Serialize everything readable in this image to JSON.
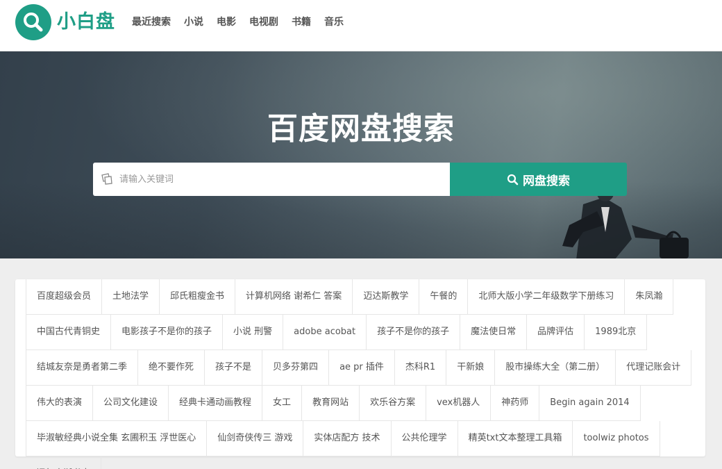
{
  "header": {
    "brand": "小白盘",
    "logo_icon": "search-icon",
    "nav": [
      "最近搜索",
      "小说",
      "电影",
      "电视剧",
      "书籍",
      "音乐"
    ]
  },
  "hero": {
    "title": "百度网盘搜索",
    "search_placeholder": "请输入关键词",
    "search_button": "网盘搜索"
  },
  "tags": [
    "百度超级会员",
    "土地法学",
    "邱氏粗瘦金书",
    "计算机网络 谢希仁 答案",
    "迈达斯教学",
    "午餐的",
    "北师大版小学二年级数学下册练习",
    "朱凤瀚",
    "中国古代青铜史",
    "电影孩子不是你的孩子",
    "小说 刑警",
    "adobe acobat",
    "孩子不是你的孩子",
    "魔法使日常",
    "品牌评估",
    "1989北京",
    "结城友奈是勇者第二季",
    "绝不要作死",
    "孩子不是",
    "贝多芬第四",
    "ae pr 插件",
    "杰科R1",
    "干新娘",
    "股市操练大全（第二册）",
    "代理记账会计",
    "伟大的表演",
    "公司文化建设",
    "经典卡通动画教程",
    "女工",
    "教育网站",
    "欢乐谷方案",
    "vex机器人",
    "神药师",
    "Begin again 2014",
    "毕淑敏经典小说全集 玄圃积玉 浮世医心",
    "仙剑奇侠传三 游戏",
    "实体店配方 技术",
    "公共伦理学",
    "精英txt文本整理工具箱",
    "toolwiz photos",
    "福尔摩斯书虫"
  ],
  "colors": {
    "accent": "#1f9e86",
    "hero_dark": "#33404b"
  }
}
